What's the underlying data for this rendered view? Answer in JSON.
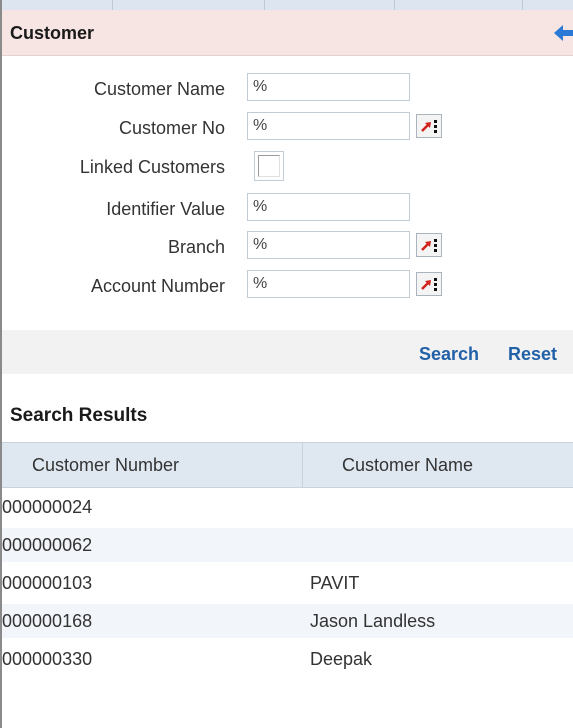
{
  "panel": {
    "title": "Customer"
  },
  "form": {
    "customer_name": {
      "label": "Customer Name",
      "value": "%"
    },
    "customer_no": {
      "label": "Customer No",
      "value": "%"
    },
    "linked_customers": {
      "label": "Linked Customers",
      "checked": false
    },
    "identifier_value": {
      "label": "Identifier Value",
      "value": "%"
    },
    "branch": {
      "label": "Branch",
      "value": "%"
    },
    "account_number": {
      "label": "Account Number",
      "value": "%"
    }
  },
  "actions": {
    "search": "Search",
    "reset": "Reset"
  },
  "results": {
    "title": "Search Results",
    "columns": [
      "Customer Number",
      "Customer Name"
    ],
    "rows": [
      {
        "number": "000000024",
        "name": ""
      },
      {
        "number": "000000062",
        "name": ""
      },
      {
        "number": "000000103",
        "name": "PAVIT"
      },
      {
        "number": "000000168",
        "name": "Jason Landless"
      },
      {
        "number": "000000330",
        "name": "Deepak"
      }
    ]
  },
  "colors": {
    "header_bg": "#f7e5e3",
    "link": "#2261a8",
    "lov_arrow": "#d0211b",
    "back_arrow": "#2a7ad5"
  },
  "icons": {
    "lov": "lov-list-icon",
    "back": "back-arrow-icon"
  }
}
